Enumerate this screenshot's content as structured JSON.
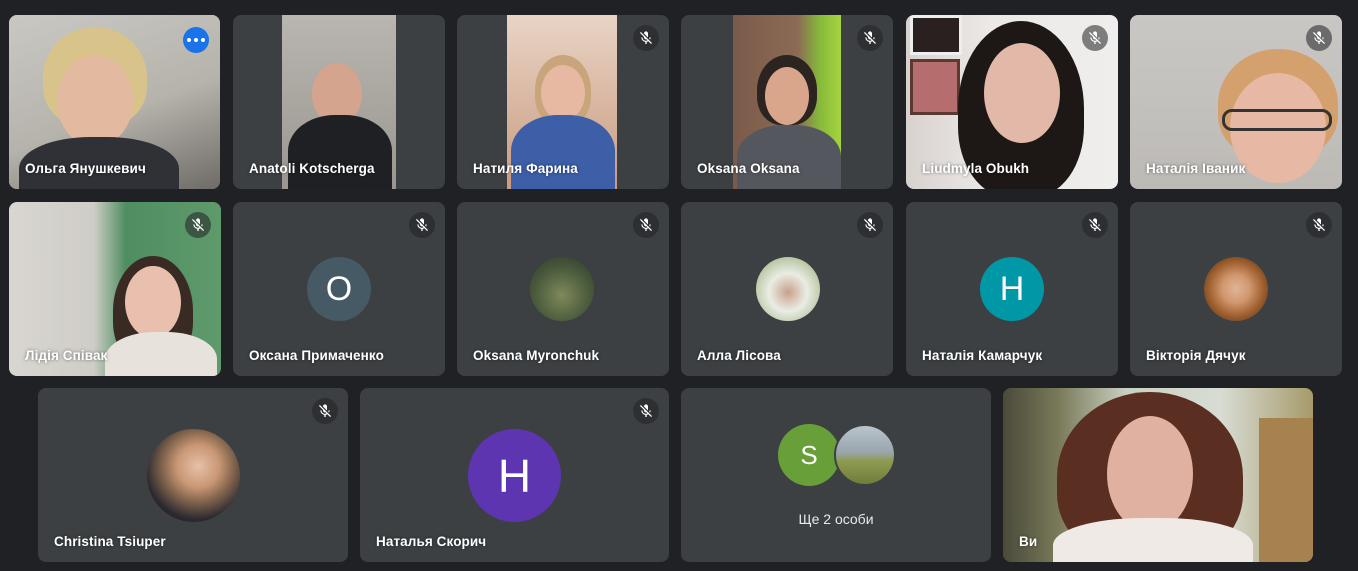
{
  "participants": [
    {
      "name": "Ольга Янушкевич"
    },
    {
      "name": "Anatoli Kotscherga"
    },
    {
      "name": "Натиля Фарина"
    },
    {
      "name": "Oksana Oksana"
    },
    {
      "name": "Liudmyla Obukh"
    },
    {
      "name": "Наталія Іваник"
    },
    {
      "name": "Лідія Співак"
    },
    {
      "name": "Оксана Примаченко",
      "initial": "О"
    },
    {
      "name": "Oksana Myronchuk"
    },
    {
      "name": "Алла Лісова"
    },
    {
      "name": "Наталія Камарчук",
      "initial": "Н"
    },
    {
      "name": "Вікторія Дячук"
    },
    {
      "name": "Christina Tsiuper"
    },
    {
      "name": "Наталья Скорич",
      "initial": "Н"
    },
    {
      "name": "Ви"
    }
  ],
  "others": {
    "label": "Ще 2 особи",
    "initial": "S"
  },
  "colors": {
    "tile": "#3c4043",
    "background": "#202124",
    "active_outline": "#8ab4f8",
    "avatar_slate": "#455a64",
    "avatar_teal": "#0097a7",
    "avatar_purple": "#5e35b1",
    "avatar_green": "#689f38",
    "more_button": "#1a73e8"
  },
  "icons": {
    "muted": "mic-off-icon",
    "more": "more-options-icon"
  }
}
